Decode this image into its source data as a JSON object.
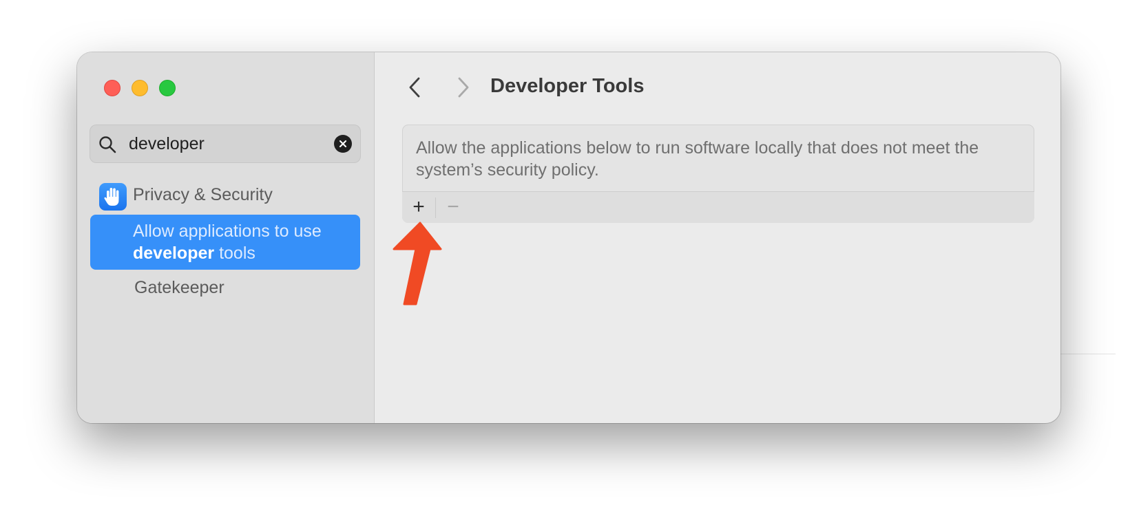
{
  "window": {
    "traffic_lights": {
      "close_color": "#fe5f57",
      "minimize_color": "#febc2e",
      "maximize_color": "#28c840"
    }
  },
  "sidebar": {
    "search": {
      "value": "developer",
      "icon": "search-icon",
      "clear_icon": "clear-icon"
    },
    "privacy": {
      "label": "Privacy & Security",
      "icon": "hand-icon",
      "icon_color": "#1a74ee"
    },
    "selected_item": {
      "text_before": "Allow applications to use",
      "highlight": "developer",
      "text_after": "tools",
      "background": "#3690f9"
    },
    "gatekeeper": {
      "label": "Gatekeeper"
    }
  },
  "content": {
    "title": "Developer Tools",
    "nav": {
      "back_icon": "chevron-left-icon",
      "forward_icon": "chevron-right-icon"
    },
    "panel": {
      "description": "Allow the applications below to run software locally that does not meet the system’s security policy.",
      "add_label": "+",
      "remove_label": "−"
    },
    "annotation": {
      "icon": "red-arrow-icon",
      "color": "#f04a24"
    }
  }
}
